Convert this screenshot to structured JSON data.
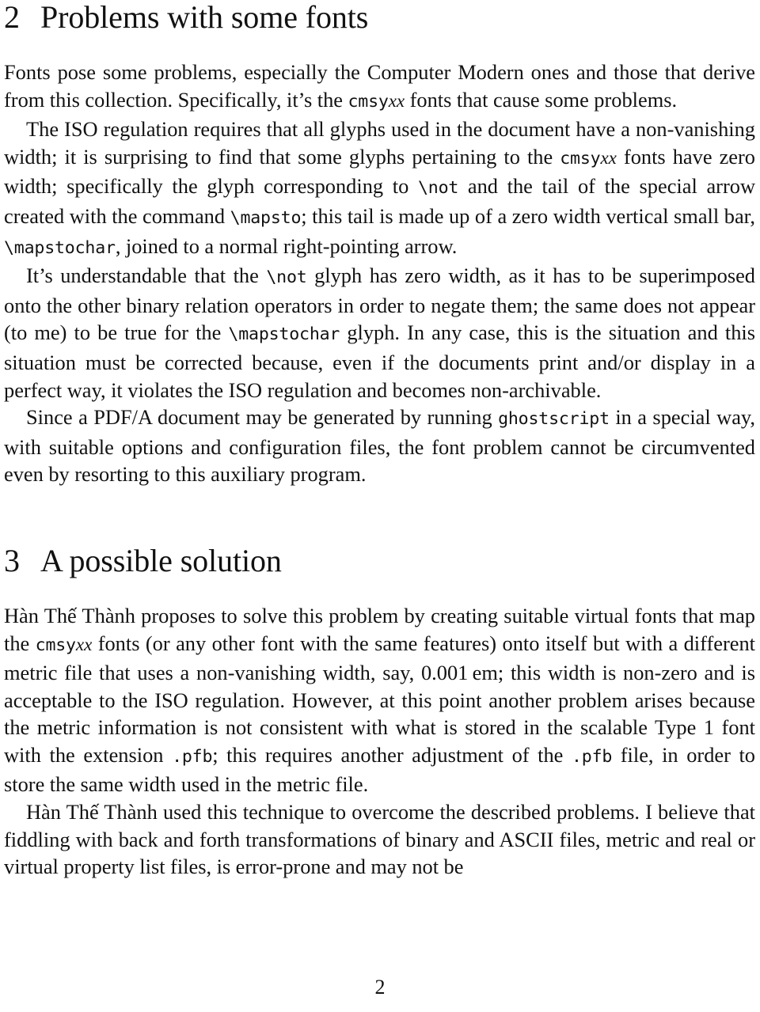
{
  "document": {
    "page_number": "2",
    "sections": [
      {
        "number": "2",
        "title": "Problems with some fonts"
      },
      {
        "number": "3",
        "title": "A possible solution"
      }
    ]
  },
  "section2": {
    "paragraph1": {
      "part1": "Fonts pose some problems, especially the Computer Modern ones and those that derive from this collection. Specifically, it’s the ",
      "code1": "cmsy",
      "math1": "xx",
      "part2": " fonts that cause some problems."
    },
    "paragraph2": {
      "part1": "The ISO regulation requires that all glyphs used in the document have a non-vanishing width; it is surprising to find that some glyphs pertaining to the ",
      "code1": "cmsy",
      "math1": "xx",
      "part2": " fonts have zero width; specifically the glyph corresponding to ",
      "code2": "\\not",
      "part3": " and the tail of the special arrow created with the command ",
      "code3": "\\mapsto",
      "part4": "; this tail is made up of a zero width vertical small bar, ",
      "code4": "\\mapstochar",
      "part5": ", joined to a normal right-pointing arrow."
    },
    "paragraph3": {
      "part1": "It’s understandable that the ",
      "code1": "\\not",
      "part2": " glyph has zero width, as it has to be superimposed onto the other binary relation operators in order to negate them; the same does not appear (to me) to be true for the ",
      "code2": "\\mapstochar",
      "part3": " glyph. In any case, this is the situation and this situation must be corrected because, even if the documents print and/or display in a perfect way, it violates the ISO regulation and becomes non-archivable."
    },
    "paragraph4": {
      "part1": "Since a PDF/A document may be generated by running ",
      "code1": "ghostscript",
      "part2": " in a special way, with suitable options and configuration files, the font problem cannot be circumvented even by resorting to this auxiliary program."
    }
  },
  "section3": {
    "paragraph1": {
      "part1": "Hàn Thế Thành proposes to solve this problem by creating suitable virtual fonts that map the ",
      "code1": "cmsy",
      "math1": "xx",
      "part2": " fonts (or any other font with the same features) onto itself but with a different metric file that uses a non-vanishing width, say, 0.001 em; this width is non-zero and is acceptable to the ISO regulation. However, at this point another problem arises because the metric information is not consistent with what is stored in the scalable Type 1 font with the extension ",
      "code2": ".pfb",
      "part3": "; this requires another adjustment of the ",
      "code3": ".pfb",
      "part4": " file, in order to store the same width used in the metric file."
    },
    "paragraph2": {
      "part1": "Hàn Thế Thành used this technique to overcome the described problems. I believe that fiddling with back and forth transformations of binary and ASCII files, metric and real or virtual property list files, is error-prone and may not be"
    }
  }
}
